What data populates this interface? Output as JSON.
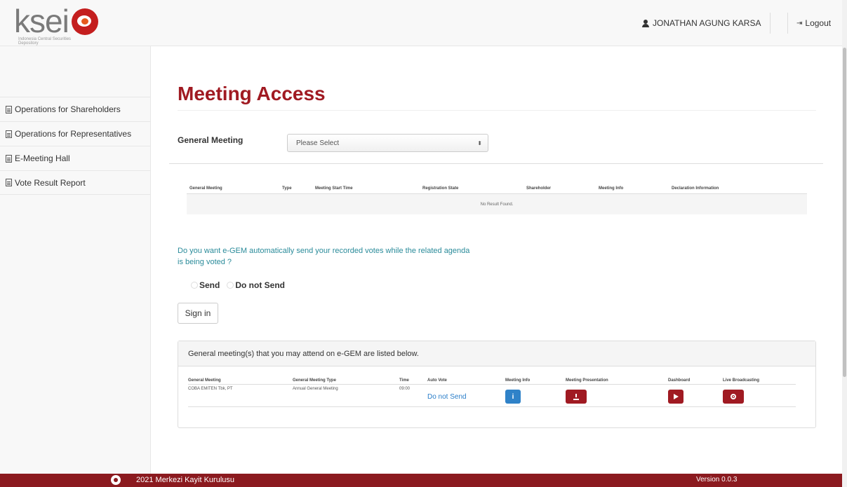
{
  "header": {
    "logo_text": "ksei",
    "logo_sub": "Indonesia Central Securities Depository",
    "user_name": "JONATHAN AGUNG KARSA",
    "logout_label": "Logout"
  },
  "sidebar": {
    "items": [
      {
        "label": "Operations for Shareholders",
        "icon": "document-icon"
      },
      {
        "label": "Operations for Representatives",
        "icon": "document-icon"
      },
      {
        "label": "E-Meeting Hall",
        "icon": "document-icon"
      },
      {
        "label": "Vote Result Report",
        "icon": "document-icon"
      }
    ]
  },
  "main": {
    "title": "Meeting Access",
    "general_meeting_label": "General Meeting",
    "select_value": "Please Select",
    "results_table": {
      "headers": [
        "General Meeting",
        "Type",
        "Meeting Start Time",
        "Registration State",
        "Shareholder",
        "Meeting Info",
        "Declaration Information"
      ],
      "empty_text": "No Result Found."
    },
    "question": "Do you want e-GEM automatically send your recorded votes while the related agenda is being voted ?",
    "radio_send": "Send",
    "radio_do_not_send": "Do not Send",
    "signin_label": "Sign in",
    "panel": {
      "heading": "General meeting(s) that you may attend on e-GEM are listed below.",
      "headers": [
        "General Meeting",
        "General Meeting Type",
        "Time",
        "Auto Vote",
        "Meeting Info",
        "Meeting Presentation",
        "Dashboard",
        "Live Broadcasting"
      ],
      "rows": [
        {
          "meeting": "COBA EMITEN Tbk, PT",
          "type": "Annual General Meeting",
          "time": "09:00",
          "auto_vote": "Do not Send"
        }
      ]
    }
  },
  "footer": {
    "copyright": "2021 Merkezi Kayit Kurulusu",
    "version": "Version 0.0.3"
  },
  "colors": {
    "brand_red": "#a01a22",
    "footer_red": "#8b1a1f",
    "link_blue": "#2a7ec9",
    "question_teal": "#2a8b9a",
    "info_blue": "#2f82c8"
  }
}
